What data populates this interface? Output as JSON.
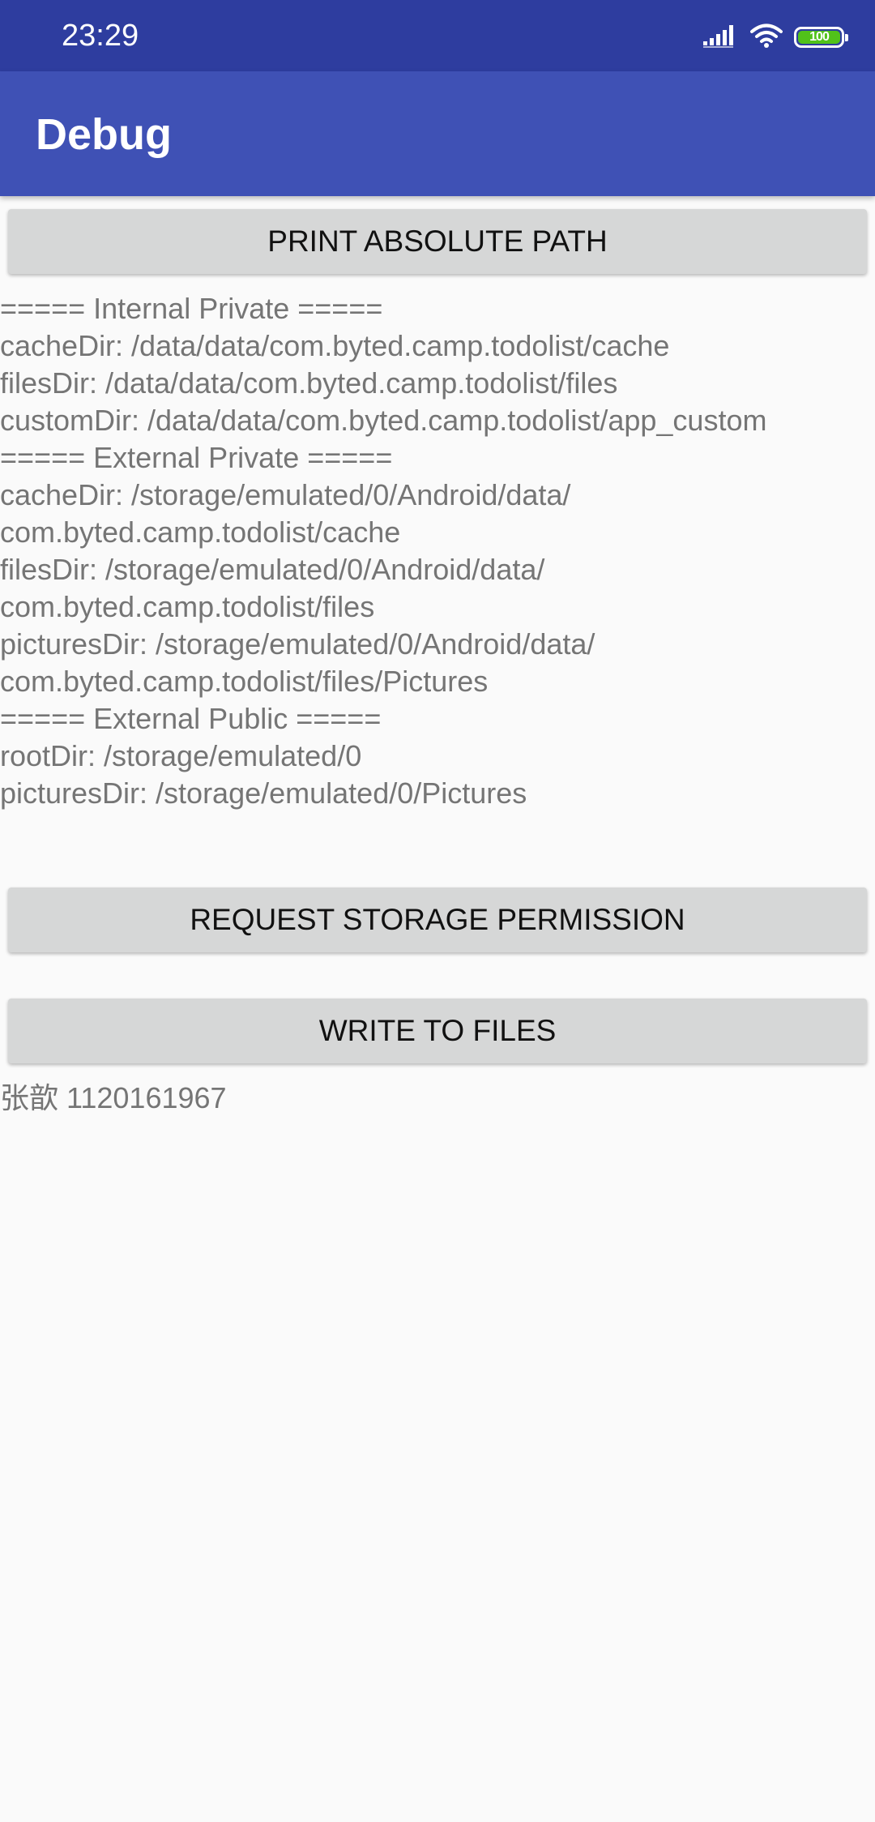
{
  "status_bar": {
    "time": "23:29",
    "battery_level": "100",
    "icons": [
      "signal-icon",
      "wifi-icon",
      "battery-icon"
    ],
    "battery_color": "#51c21a"
  },
  "app_bar": {
    "title": "Debug",
    "color": "#3f51b5"
  },
  "buttons": {
    "print_path": "PRINT ABSOLUTE PATH",
    "request_permission": "REQUEST STORAGE PERMISSION",
    "write_files": "WRITE TO FILES"
  },
  "path_output": {
    "lines": [
      "===== Internal Private =====",
      "cacheDir: /data/data/com.byted.camp.todolist/cache",
      "filesDir: /data/data/com.byted.camp.todolist/files",
      "customDir: /data/data/com.byted.camp.todolist/app_custom",
      "===== External Private =====",
      "cacheDir: /storage/emulated/0/Android/data/",
      "com.byted.camp.todolist/cache",
      "filesDir: /storage/emulated/0/Android/data/",
      "com.byted.camp.todolist/files",
      "picturesDir: /storage/emulated/0/Android/data/",
      "com.byted.camp.todolist/files/Pictures",
      "===== External Public =====",
      "rootDir: /storage/emulated/0",
      "picturesDir: /storage/emulated/0/Pictures"
    ]
  },
  "write_output": {
    "text": "张歆 1120161967"
  }
}
